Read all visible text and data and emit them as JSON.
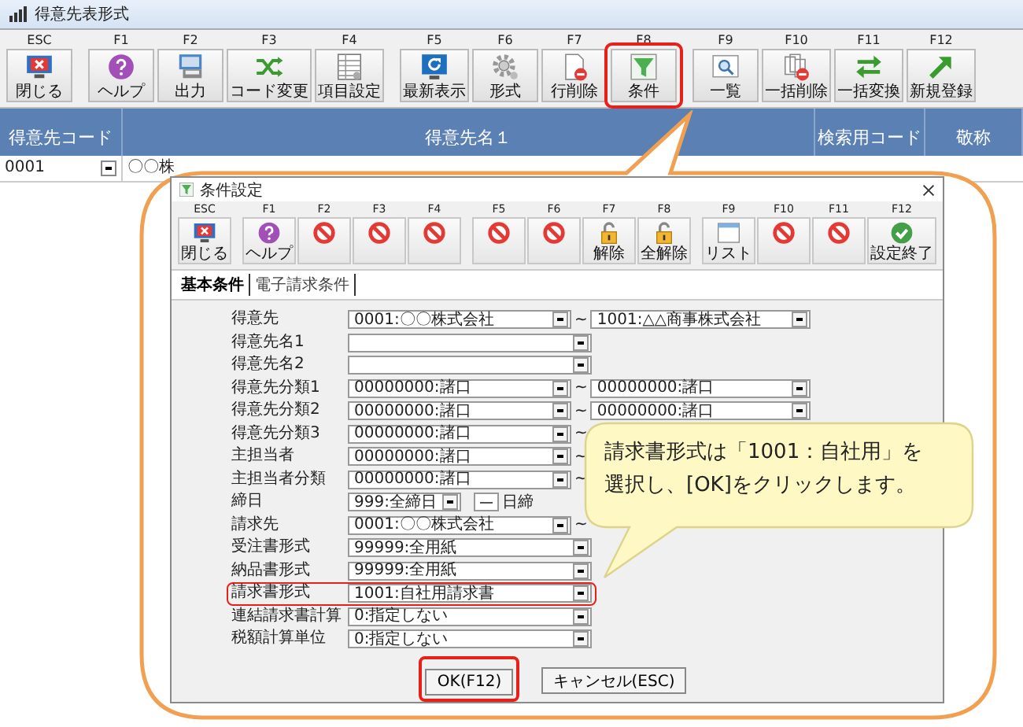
{
  "main_window": {
    "title": "得意先表形式",
    "toolbar": [
      {
        "key": "ESC",
        "label": "閉じる",
        "kind": "close",
        "highlighted": false
      },
      {
        "key": "F1",
        "label": "ヘルプ",
        "kind": "help",
        "highlighted": false
      },
      {
        "key": "F2",
        "label": "出力",
        "kind": "print",
        "highlighted": false
      },
      {
        "key": "F3",
        "label": "コード変更",
        "kind": "shuffle",
        "highlighted": false
      },
      {
        "key": "F4",
        "label": "項目設定",
        "kind": "table",
        "highlighted": false
      },
      {
        "key": "F5",
        "label": "最新表示",
        "kind": "refresh",
        "highlighted": false
      },
      {
        "key": "F6",
        "label": "形式",
        "kind": "gear",
        "highlighted": false
      },
      {
        "key": "F7",
        "label": "行削除",
        "kind": "delete-doc",
        "highlighted": false
      },
      {
        "key": "F8",
        "label": "条件",
        "kind": "filter",
        "highlighted": true
      },
      {
        "key": "F9",
        "label": "一覧",
        "kind": "search",
        "highlighted": false
      },
      {
        "key": "F10",
        "label": "一括削除",
        "kind": "multi-delete",
        "highlighted": false
      },
      {
        "key": "F11",
        "label": "一括変換",
        "kind": "swap",
        "highlighted": false
      },
      {
        "key": "F12",
        "label": "新規登録",
        "kind": "arrow",
        "highlighted": false
      }
    ],
    "table": {
      "columns": [
        "得意先コード",
        "得意先名１",
        "検索用コード",
        "敬称"
      ],
      "rows": [
        {
          "code": "0001",
          "name": "〇〇株"
        }
      ]
    }
  },
  "dialog": {
    "title": "条件設定",
    "toolbar": [
      {
        "key": "ESC",
        "label": "閉じる",
        "kind": "close"
      },
      {
        "key": "F1",
        "label": "ヘルプ",
        "kind": "help"
      },
      {
        "key": "F2",
        "kind": "disabled"
      },
      {
        "key": "F3",
        "kind": "disabled"
      },
      {
        "key": "F4",
        "kind": "disabled"
      },
      {
        "key": "F5",
        "kind": "disabled"
      },
      {
        "key": "F6",
        "kind": "disabled"
      },
      {
        "key": "F7",
        "label": "解除",
        "kind": "lock"
      },
      {
        "key": "F8",
        "label": "全解除",
        "kind": "lock"
      },
      {
        "key": "F9",
        "label": "リスト",
        "kind": "list"
      },
      {
        "key": "F10",
        "kind": "disabled"
      },
      {
        "key": "F11",
        "kind": "disabled"
      },
      {
        "key": "F12",
        "label": "設定終了",
        "kind": "check"
      }
    ],
    "tabs": [
      {
        "label": "基本条件",
        "selected": true
      },
      {
        "label": "電子請求条件",
        "selected": false
      }
    ],
    "rows": [
      {
        "kind": "range",
        "label": "得意先",
        "value": "0001:〇〇株式会社",
        "tilde": "~",
        "to_value": "1001:△△商事株式会社",
        "highlighted": false
      },
      {
        "kind": "single",
        "label": "得意先名1",
        "highlighted": false
      },
      {
        "kind": "single",
        "label": "得意先名2",
        "highlighted": false
      },
      {
        "kind": "range",
        "label": "得意先分類1",
        "value": "00000000:諸口",
        "tilde": "~",
        "to_value": "00000000:諸口",
        "highlighted": false
      },
      {
        "kind": "range",
        "label": "得意先分類2",
        "value": "00000000:諸口",
        "tilde": "~",
        "to_value": "00000000:諸口",
        "highlighted": false
      },
      {
        "kind": "range",
        "label": "得意先分類3",
        "value": "00000000:諸口",
        "tilde": "~",
        "highlighted": false
      },
      {
        "kind": "range",
        "label": "主担当者",
        "value": "00000000:諸口",
        "tilde": "~",
        "highlighted": false
      },
      {
        "kind": "range",
        "label": "主担当者分類",
        "value": "00000000:諸口",
        "tilde": "~",
        "highlighted": false
      },
      {
        "kind": "closing",
        "label": "締日",
        "value": "999:全締日",
        "suffix": "日締",
        "highlighted": false
      },
      {
        "kind": "range",
        "label": "請求先",
        "value": "0001:〇〇株式会社",
        "tilde": "~",
        "highlighted": false
      },
      {
        "kind": "single",
        "label": "受注書形式",
        "value": "99999:全用紙",
        "highlighted": false
      },
      {
        "kind": "single",
        "label": "納品書形式",
        "value": "99999:全用紙",
        "highlighted": false
      },
      {
        "kind": "single",
        "label": "請求書形式",
        "value": "1001:自社用請求書",
        "highlighted": true
      },
      {
        "kind": "single",
        "label": "連結請求書計算",
        "value": "0:指定しない",
        "highlighted": false
      },
      {
        "kind": "single",
        "label": "税額計算単位",
        "value": "0:指定しない",
        "highlighted": false
      }
    ],
    "buttons": [
      {
        "label": "OK(F12)",
        "highlighted": true
      },
      {
        "label": "キャンセル(ESC)",
        "highlighted": false
      }
    ]
  },
  "tooltip": {
    "lines": [
      "請求書形式は「1001：自社用」を",
      "選択し、[OK]をクリックします。"
    ]
  }
}
